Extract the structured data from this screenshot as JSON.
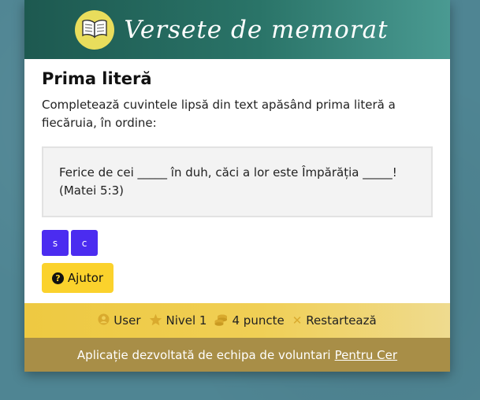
{
  "header": {
    "title": "Versete de memorat",
    "logo_icon": "open-book-icon"
  },
  "main": {
    "title": "Prima literă",
    "instructions": "Completează cuvintele lipsă din text apăsând prima literă a fiecăruia, în ordine:",
    "verse": {
      "text": "Ferice de cei _____ în duh, căci a lor este Împărăția _____!",
      "reference": "(Matei 5:3)"
    },
    "letter_buttons": [
      "s",
      "c"
    ],
    "help_label": "Ajutor"
  },
  "status": {
    "user_label": "User",
    "level_label": "Nivel 1",
    "points_label": "4 puncte",
    "restart_label": "Restartează"
  },
  "footer": {
    "text": "Aplicație dezvoltată de echipa de voluntari",
    "link_label": "Pentru Cer"
  },
  "colors": {
    "header_start": "#1d5950",
    "letter_button": "#4b2cf0",
    "help_button": "#fbd22c",
    "status_bar": "#eec941",
    "footer": "#a88e47"
  }
}
